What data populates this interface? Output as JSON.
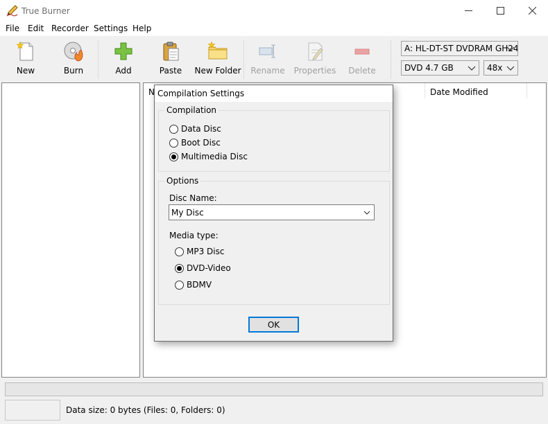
{
  "window": {
    "title": "True Burner"
  },
  "menu": [
    "File",
    "Edit",
    "Recorder",
    "Settings",
    "Help"
  ],
  "toolbar": {
    "new": "New",
    "burn": "Burn",
    "add": "Add",
    "paste": "Paste",
    "new_folder": "New Folder",
    "rename": "Rename",
    "properties": "Properties",
    "delete": "Delete"
  },
  "drive": {
    "device": "A: HL-DT-ST DVDRAM GH24",
    "disc_type": "DVD 4.7 GB",
    "speed": "48x"
  },
  "file_list": {
    "col_name": "N",
    "col_date": "Date Modified"
  },
  "status": {
    "text": "Data size: 0 bytes (Files: 0, Folders: 0)"
  },
  "dialog": {
    "title": "Compilation Settings",
    "compilation_group": "Compilation",
    "compilation_options": [
      "Data Disc",
      "Boot Disc",
      "Multimedia Disc"
    ],
    "compilation_selected": "Multimedia Disc",
    "options_group": "Options",
    "disc_name_label": "Disc Name:",
    "disc_name_value": "My Disc",
    "media_type_label": "Media type:",
    "media_options": [
      "MP3 Disc",
      "DVD-Video",
      "BDMV"
    ],
    "media_selected": "DVD-Video",
    "ok": "OK"
  },
  "colors": {
    "accent": "#0078d7",
    "window_bg": "#f0f0f0"
  }
}
